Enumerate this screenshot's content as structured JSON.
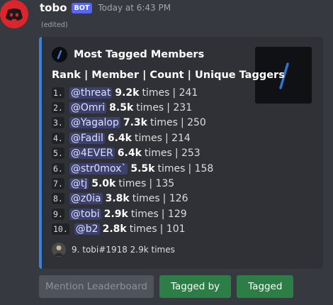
{
  "message": {
    "username": "tobo",
    "badge": "BOT",
    "timestamp": "Today at 6:43 PM",
    "edited": "(edited)"
  },
  "embed": {
    "accent_color": "#3b82d6",
    "author": "Most Tagged Members",
    "title": "Rank | Member | Count | Unique Taggers",
    "rows": [
      {
        "rank": "1.",
        "member": "@threat",
        "count": "9.2k",
        "times": "times",
        "rest": "| 241"
      },
      {
        "rank": "2.",
        "member": "@Omri",
        "count": "8.5k",
        "times": "times",
        "rest": "| 231"
      },
      {
        "rank": "3.",
        "member": "@Yagalop",
        "count": "7.3k",
        "times": "times",
        "rest": "| 250"
      },
      {
        "rank": "4.",
        "member": "@Fadil",
        "count": "6.4k",
        "times": "times",
        "rest": "| 214"
      },
      {
        "rank": "5.",
        "member": "@4EVER",
        "count": "6.4k",
        "times": "times",
        "rest": "| 253"
      },
      {
        "rank": "6.",
        "member": "@str0mox`",
        "count": "5.5k",
        "times": "times",
        "rest": "| 158"
      },
      {
        "rank": "7.",
        "member": "@tj",
        "count": "5.0k",
        "times": "times",
        "rest": "| 135"
      },
      {
        "rank": "8.",
        "member": "@z0ia",
        "count": "3.8k",
        "times": "times",
        "rest": "| 126"
      },
      {
        "rank": "9.",
        "member": "@tobi",
        "count": "2.9k",
        "times": "times",
        "rest": "| 129"
      },
      {
        "rank": "10.",
        "member": "@b2",
        "count": "2.8k",
        "times": "times",
        "rest": "| 101"
      }
    ],
    "footer": "9. tobi#1918 2.9k times"
  },
  "buttons": {
    "mention_leaderboard": "Mention Leaderboard",
    "tagged_by": "Tagged by",
    "tagged": "Tagged"
  },
  "icons": {
    "avatar": "discord-logo-icon",
    "author": "slash-logo-icon",
    "thumbnail": "slash-logo-thumbnail",
    "footer": "user-avatar-icon"
  }
}
